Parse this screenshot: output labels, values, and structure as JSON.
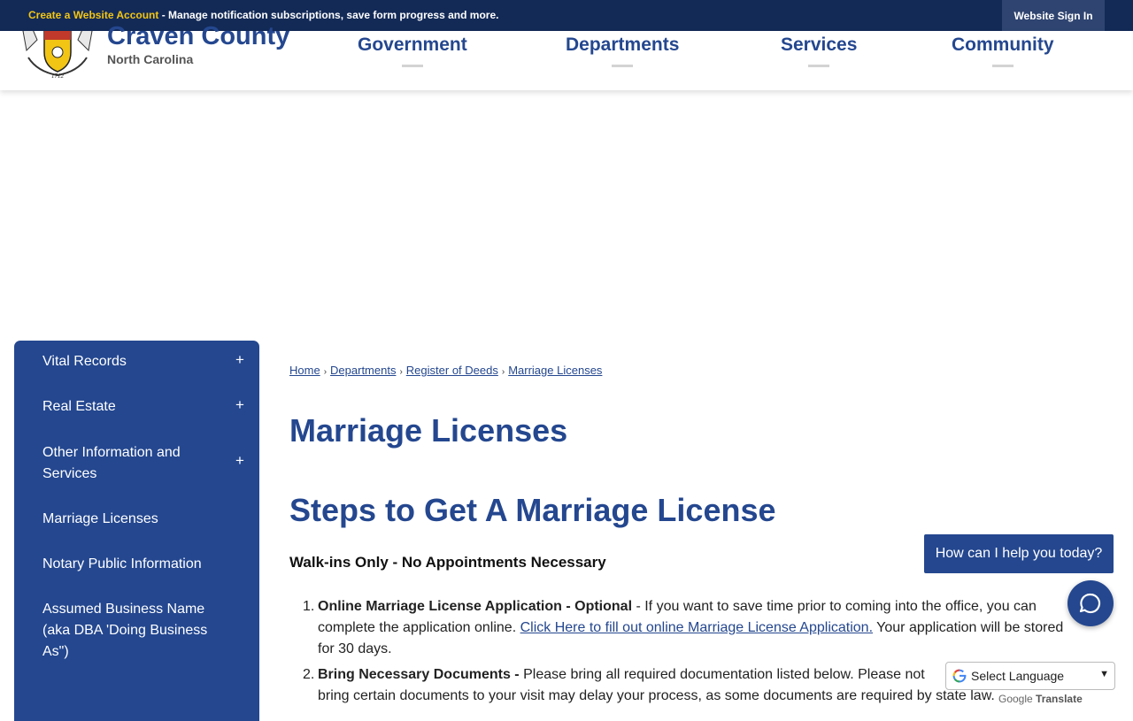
{
  "topbar": {
    "highlight": "Create a Website Account",
    "message": " - Manage notification subscriptions, save form progress and more.",
    "signin": "Website Sign In"
  },
  "brand": {
    "title": "Craven County",
    "subtitle": "North Carolina",
    "seal_year": "1712"
  },
  "nav": [
    "Government",
    "Departments",
    "Services",
    "Community"
  ],
  "sidebar": {
    "items": [
      {
        "label": "Vital Records",
        "expandable": true
      },
      {
        "label": "Real Estate",
        "expandable": true
      },
      {
        "label": "Other Information and Services",
        "expandable": true
      },
      {
        "label": "Marriage Licenses",
        "expandable": false
      },
      {
        "label": "Notary Public Information",
        "expandable": false
      },
      {
        "label": "Assumed Business Name (aka DBA 'Doing Business As\")",
        "expandable": false
      }
    ],
    "expand_symbol": "+"
  },
  "breadcrumb": [
    "Home",
    "Departments",
    "Register of Deeds",
    "Marriage Licenses"
  ],
  "breadcrumb_sep": "›",
  "page_title": "Marriage Licenses",
  "section_title": "Steps to Get A Marriage License",
  "walkins": "Walk-ins Only - No Appointments Necessary",
  "steps": [
    {
      "num": "1.",
      "bold": "Online Marriage License Application - Optional",
      "text1": " - If you want to save time prior to coming into the office, you can complete the application online. ",
      "link": "Click Here to fill out online Marriage License Application.",
      "text2": "  Your application will be stored for 30 days."
    },
    {
      "num": "2.",
      "bold": "Bring Necessary Documents -",
      "text1": " Please bring all required documentation listed below. Please not",
      "text2": "bring certain documents to your visit may delay your process, as some documents are required by state law."
    }
  ],
  "chat": {
    "prompt": "How can I help you today?",
    "icon": "chat-bubble-icon"
  },
  "translate": {
    "select_label": "Select Language",
    "powered_prefix": "Google",
    "powered_label": "Translate"
  },
  "colors": {
    "primary": "#24478f",
    "topbar": "#132a57",
    "highlight": "#f2c515"
  }
}
